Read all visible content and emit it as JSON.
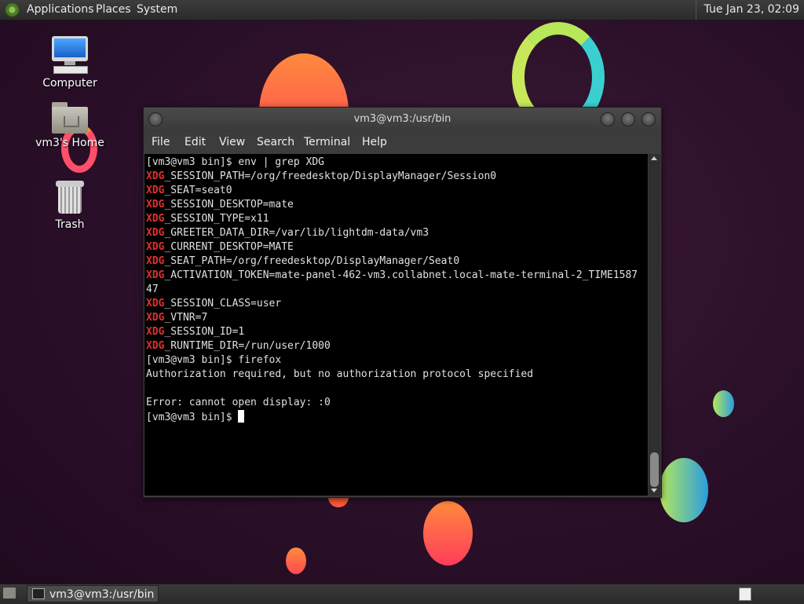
{
  "top_panel": {
    "menus": [
      "Applications",
      "Places",
      "System"
    ],
    "clock": "Tue Jan 23, 02:09"
  },
  "desktop_icons": [
    {
      "label": "Computer",
      "icon": "computer-icon"
    },
    {
      "label": "vm3's Home",
      "icon": "home-folder-icon"
    },
    {
      "label": "Trash",
      "icon": "trash-icon"
    }
  ],
  "terminal": {
    "title": "vm3@vm3:/usr/bin",
    "menu": [
      "File",
      "Edit",
      "View",
      "Search",
      "Terminal",
      "Help"
    ],
    "lines": [
      {
        "prefix": "",
        "text": "[vm3@vm3 bin]$ env | grep XDG"
      },
      {
        "prefix": "XDG",
        "text": "_SESSION_PATH=/org/freedesktop/DisplayManager/Session0"
      },
      {
        "prefix": "XDG",
        "text": "_SEAT=seat0"
      },
      {
        "prefix": "XDG",
        "text": "_SESSION_DESKTOP=mate"
      },
      {
        "prefix": "XDG",
        "text": "_SESSION_TYPE=x11"
      },
      {
        "prefix": "XDG",
        "text": "_GREETER_DATA_DIR=/var/lib/lightdm-data/vm3"
      },
      {
        "prefix": "XDG",
        "text": "_CURRENT_DESKTOP=MATE"
      },
      {
        "prefix": "XDG",
        "text": "_SEAT_PATH=/org/freedesktop/DisplayManager/Seat0"
      },
      {
        "prefix": "XDG",
        "text": "_ACTIVATION_TOKEN=mate-panel-462-vm3.collabnet.local-mate-terminal-2_TIME1587"
      },
      {
        "prefix": "",
        "text": "47"
      },
      {
        "prefix": "XDG",
        "text": "_SESSION_CLASS=user"
      },
      {
        "prefix": "XDG",
        "text": "_VTNR=7"
      },
      {
        "prefix": "XDG",
        "text": "_SESSION_ID=1"
      },
      {
        "prefix": "XDG",
        "text": "_RUNTIME_DIR=/run/user/1000"
      },
      {
        "prefix": "",
        "text": "[vm3@vm3 bin]$ firefox"
      },
      {
        "prefix": "",
        "text": "Authorization required, but no authorization protocol specified"
      },
      {
        "prefix": "",
        "text": ""
      },
      {
        "prefix": "",
        "text": "Error: cannot open display: :0"
      }
    ],
    "prompt": "[vm3@vm3 bin]$ ",
    "highlight_color": "#e03030"
  },
  "bottom_panel": {
    "task_label": "vm3@vm3:/usr/bin"
  }
}
